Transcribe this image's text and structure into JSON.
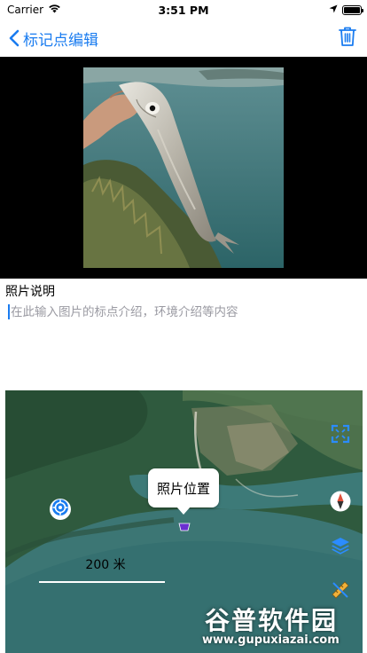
{
  "status_bar": {
    "carrier": "Carrier",
    "time": "3:51 PM",
    "battery_level": 1.0
  },
  "nav": {
    "back_title": "标记点编辑",
    "back_icon": "chevron-left-icon",
    "delete_icon": "trash-icon"
  },
  "photo": {
    "description": "fish-photo"
  },
  "description": {
    "title": "照片说明",
    "placeholder": "在此输入图片的标点介绍，环境介绍等内容",
    "value": ""
  },
  "map": {
    "callout_label": "照片位置",
    "scale_label": "200 米",
    "buttons": [
      "fullscreen-icon",
      "compass-icon",
      "layers-icon",
      "ruler-icon"
    ]
  },
  "watermark": {
    "main": "谷普软件园",
    "sub": "www.gupuxiazai.com"
  },
  "colors": {
    "accent": "#1a7cf0",
    "map_water": "#3d7a78",
    "map_land": "#2f5a3e"
  }
}
